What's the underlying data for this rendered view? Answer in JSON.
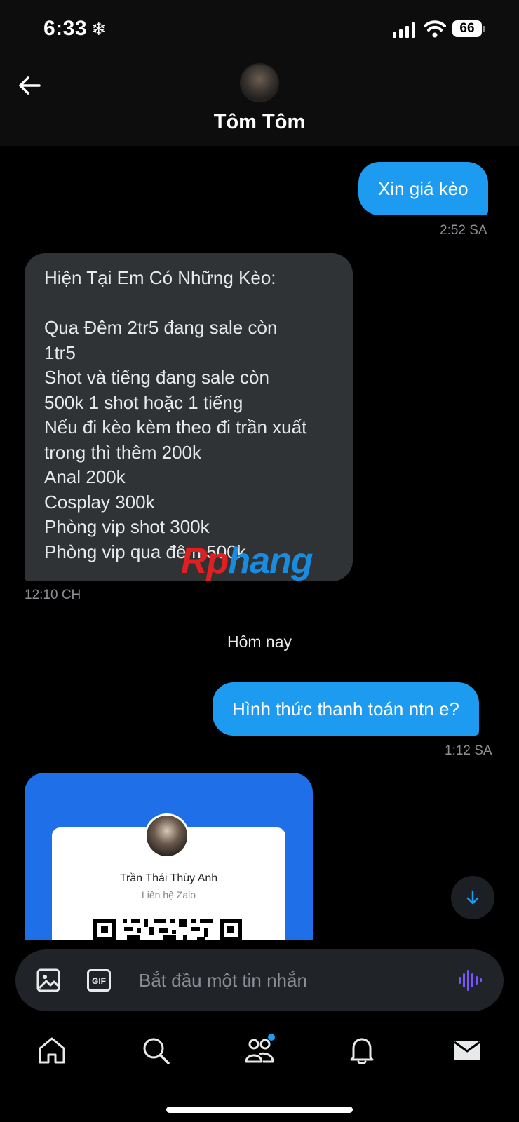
{
  "status_bar": {
    "time": "6:33",
    "mode_icon": "snowflake-icon",
    "battery": "66"
  },
  "header": {
    "name": "Tôm Tôm"
  },
  "messages": [
    {
      "direction": "out",
      "text": "Xin giá kèo",
      "time": "2:52 SA"
    },
    {
      "direction": "in",
      "lines": [
        "Hiện Tại Em Có Những Kèo:",
        "",
        "Qua Đêm 2tr5 đang sale còn",
        "1tr5",
        "Shot và tiếng đang sale còn",
        "500k 1 shot hoặc 1 tiếng",
        "Nếu đi kèo kèm theo đi trần xuất",
        "trong thì thêm 200k",
        "Anal 200k",
        "Cosplay 300k",
        "Phòng vip shot 300k",
        "Phòng vip qua đêm 500k"
      ],
      "time": "12:10 CH"
    },
    {
      "direction": "out",
      "text": "Hình thức thanh toán ntn e?",
      "time": "1:12 SA"
    }
  ],
  "watermark": {
    "part1": "Rp",
    "part2": "hang"
  },
  "day_separator": "Hôm nay",
  "zalo_card": {
    "name": "Trần Thái Thùy Anh",
    "subtitle": "Liên hệ Zalo"
  },
  "composer": {
    "placeholder": "Bắt đầu một tin nhắn",
    "value": ""
  },
  "colors": {
    "accent": "#1d9bf0",
    "incoming_bubble": "#2f3336",
    "background": "#000000",
    "voice": "#7856ff"
  },
  "nav": [
    "home-icon",
    "search-icon",
    "communities-icon",
    "notifications-icon",
    "messages-icon"
  ]
}
